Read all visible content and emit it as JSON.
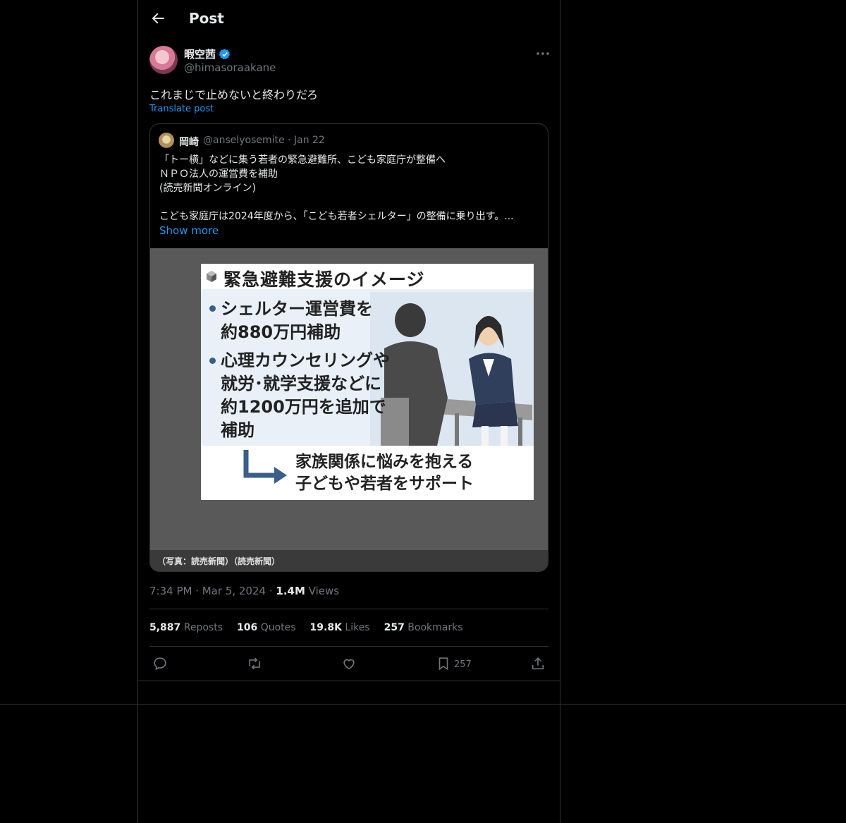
{
  "header": {
    "title": "Post"
  },
  "post": {
    "display_name": "暇空茜",
    "handle": "@himasoraakane",
    "text": "これまじで止めないと終わりだろ",
    "translate_label": "Translate post",
    "timestamp": "7:34 PM · Mar 5, 2024",
    "views_count": "1.4M",
    "views_label": "Views"
  },
  "quote": {
    "display_name": "岡崎",
    "handle_date": "@anselyosemite · Jan 22",
    "lines": [
      "「トー横」などに集う若者の緊急避難所、こども家庭庁が整備へ",
      "ＮＰＯ法人の運営費を補助",
      "(読売新聞オンライン)",
      "",
      "こども家庭庁は2024年度から、「こども若者シェルター」の整備に乗り出す。..."
    ],
    "show_more": "Show more",
    "image": {
      "title": "緊急避難支援のイメージ",
      "bullet1": [
        "シェルター運営費を",
        "約880万円補助"
      ],
      "bullet2": [
        "心理カウンセリングや",
        "就労･就学支援などに",
        "約1200万円を追加で",
        "補助"
      ],
      "bottom": [
        "家族関係に悩みを抱える",
        "子どもや若者をサポート"
      ]
    },
    "caption": "（写真：読売新聞）（読売新聞）"
  },
  "stats": {
    "reposts_count": "5,887",
    "reposts_label": "Reposts",
    "quotes_count": "106",
    "quotes_label": "Quotes",
    "likes_count": "19.8K",
    "likes_label": "Likes",
    "bookmarks_count": "257",
    "bookmarks_label": "Bookmarks"
  },
  "actions": {
    "bookmark_count": "257"
  },
  "icons": [
    "back-arrow-icon",
    "verified-badge-icon",
    "more-icon",
    "reply-icon",
    "repost-icon",
    "like-icon",
    "bookmark-icon",
    "share-icon"
  ],
  "colors": {
    "background": "#000000",
    "accent": "#1d9bf0",
    "muted": "#71767b",
    "border": "#2f3336"
  }
}
